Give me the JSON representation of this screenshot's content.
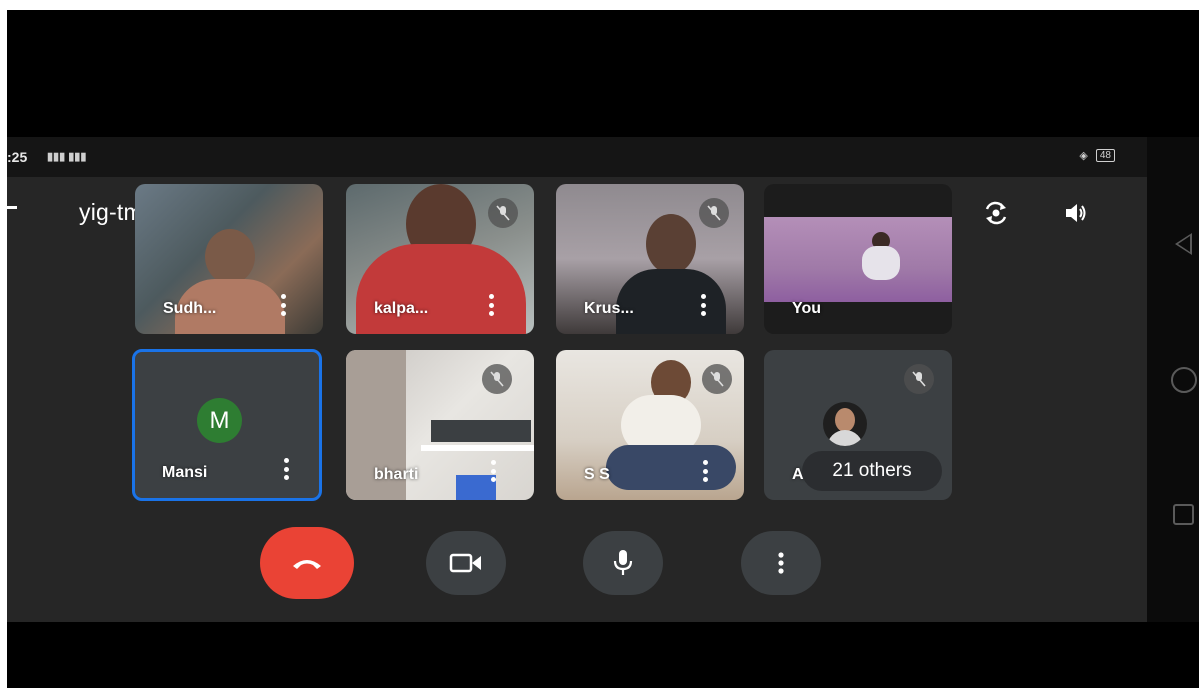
{
  "status_bar": {
    "time": ":25",
    "signal": "ᵛᵒ ˡᵗᵉ LTE",
    "battery": "48"
  },
  "header": {
    "meeting_code": "yig-tmdq-dbg"
  },
  "participants": [
    {
      "name": "Sudh...",
      "muted": false,
      "type": "video"
    },
    {
      "name": "kalpa...",
      "muted": true,
      "type": "video"
    },
    {
      "name": "Krus...",
      "muted": true,
      "type": "video"
    },
    {
      "name": "You",
      "muted": false,
      "type": "self"
    },
    {
      "name": "Mansi",
      "muted": false,
      "type": "avatar",
      "initial": "M",
      "active": true
    },
    {
      "name": "bharti",
      "muted": true,
      "type": "video"
    },
    {
      "name": "S S",
      "muted": true,
      "type": "video"
    },
    {
      "name": "Aa",
      "muted": true,
      "type": "others",
      "others_label": "21 others"
    }
  ],
  "controls": {
    "end_call_icon": "phone-hangup-icon",
    "camera_icon": "video-camera-icon",
    "mic_icon": "microphone-icon",
    "more_icon": "more-vertical-icon"
  },
  "colors": {
    "end_call": "#ea4335",
    "active_border": "#1a73e8",
    "avatar": "#2e7d32"
  }
}
